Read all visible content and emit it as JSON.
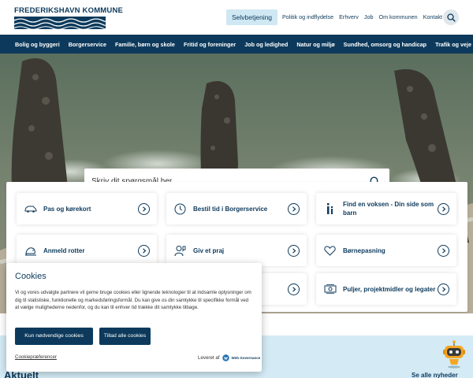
{
  "header": {
    "logo_text": "FREDERIKSHAVN KOMMUNE",
    "selvbetjening": "Selvbetjening",
    "links": [
      "Politik og indflydelse",
      "Erhverv",
      "Job",
      "Om kommunen",
      "Kontakt"
    ]
  },
  "nav": {
    "items": [
      "Bolig og byggeri",
      "Borgerservice",
      "Familie, børn og skole",
      "Fritid og foreninger",
      "Job og ledighed",
      "Natur og miljø",
      "Sundhed, omsorg og handicap",
      "Trafik og veje"
    ]
  },
  "hero": {
    "search_placeholder": "Skriv dit spørgsmål her"
  },
  "cards": [
    {
      "label": "Pas og kørekort",
      "icon": "car-icon"
    },
    {
      "label": "Bestil tid i Borgerservice",
      "icon": "clock-icon"
    },
    {
      "label": "Find en voksen - Din side som barn",
      "icon": "info-icon"
    },
    {
      "label": "Anmeld rotter",
      "icon": "rat-icon"
    },
    {
      "label": "Giv et praj",
      "icon": "person-icon"
    },
    {
      "label": "Børnepasning",
      "icon": "heart-icon"
    },
    {
      "label": "",
      "icon": ""
    },
    {
      "label": "",
      "icon": ""
    },
    {
      "label": "Puljer, projektmidler og legater",
      "icon": "money-icon"
    }
  ],
  "cookie": {
    "title": "Cookies",
    "text": "Vi og vores udvalgte partnere vil gerne bruge cookies eller lignende teknologier til at indsamle oplysninger om dig til statistiske, funktionelle og markedsføringsformål. Du kan give os din samtykke til specifikke formål ved at vælge mulighederne nedenfor, og du kan til enhver tid trække dit samtykke tilbage.",
    "btn_necessary": "Kun nødvendige cookies",
    "btn_all": "Tillad alle cookies",
    "preferences": "Cookiepræferencer",
    "powered_by": "Leveret af",
    "provider": "Web Governance"
  },
  "news": {
    "heading": "Aktuelt",
    "see_all": "Se alle nyheder"
  },
  "colors": {
    "brand": "#0d3a5c",
    "selfservice_bg": "#cfe8f3",
    "strip_bg": "#d4ebf5"
  }
}
